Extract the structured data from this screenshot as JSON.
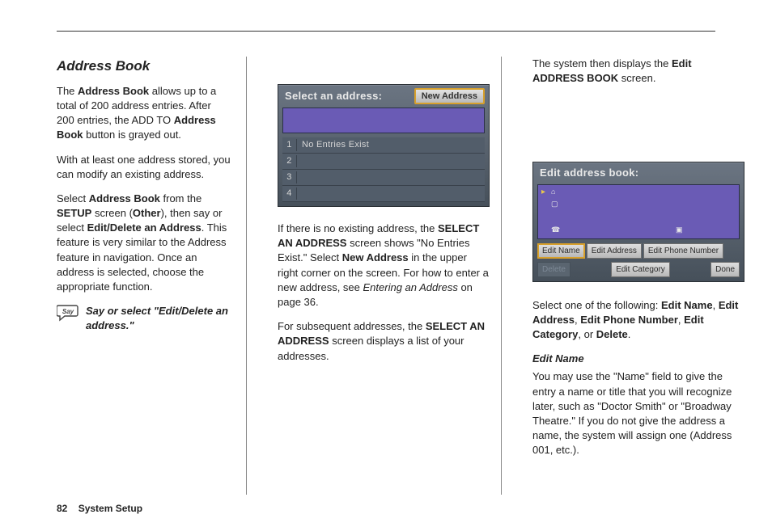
{
  "section": {
    "page_number": "82",
    "title": "System Setup"
  },
  "col1": {
    "heading": "Address Book",
    "p1_a": "The ",
    "p1_b": "Address Book",
    "p1_c": " allows up to a total of 200 address entries. After 200 entries, the ADD TO ",
    "p1_d": "Address Book",
    "p1_e": " button is grayed out.",
    "p2": "With at least one address stored, you can modify an existing address.",
    "p3": "Select ",
    "p3_b": "Address Book",
    "p3_c": " from the ",
    "p3_d": "SETUP",
    "p3_e": " screen (",
    "p3_f": "Other",
    "p3_g": "), then say or select ",
    "p3_h": "Edit/Delete an Address",
    "p3_i": ". This feature is very similar to the Address feature in navigation. Once an address is selected, choose the appropriate function.",
    "say_label": "Say",
    "say_text": "Say or select \"Edit/Delete an address.\""
  },
  "panel1": {
    "title": "Select an address:",
    "new_btn": "New Address",
    "rows": [
      "No Entries Exist",
      "",
      "",
      ""
    ]
  },
  "col2": {
    "p1": "If there is no existing address, the ",
    "p1_b": "SELECT AN ADDRESS",
    "p1_c": " screen shows \"No Entries Exist.\" Select ",
    "p1_d": "New Address",
    "p1_e": " in the upper right corner on the screen. For how to enter a new address, see ",
    "p1_f": "Entering an Address",
    "p1_g": " on page 36.",
    "p2": "For subsequent addresses, the ",
    "p2_b": "SELECT AN ADDRESS",
    "p2_c": " screen displays a list of your addresses."
  },
  "col3": {
    "p1_a": "The system then displays the ",
    "p1_b": "Edit ADDRESS BOOK",
    "p1_c": " screen.",
    "p2_a": "Select one of the following: ",
    "p2_b": "Edit Name",
    "p2_c": ", ",
    "p2_d": "Edit Address",
    "p2_e": ", ",
    "p2_f": "Edit Phone Number",
    "p2_g": ", ",
    "p2_h": "Edit Category",
    "p2_i": ", or ",
    "p2_j": "Delete",
    "p2_k": ".",
    "h_edit_name": "Edit Name",
    "p3": "You may use the \"Name\" field to give the entry a name or title that you will recognize later, such as \"Doctor Smith\" or \"Broadway Theatre.\" If you do not give the address a name, the system will assign one (Address 001, etc.)."
  },
  "panel2": {
    "title": "Edit address book:",
    "btns": {
      "edit_name": "Edit Name",
      "edit_address": "Edit Address",
      "edit_phone": "Edit Phone Number",
      "delete": "Delete",
      "edit_category": "Edit Category",
      "done": "Done"
    }
  }
}
